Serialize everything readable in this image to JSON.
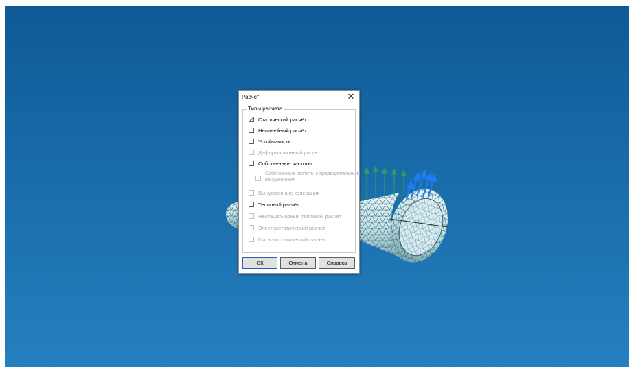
{
  "dialog": {
    "title": "Расчет",
    "close_glyph": "✕",
    "group_label": "Типы расчета",
    "options": [
      {
        "label": "Статический расчёт",
        "checked": true,
        "enabled": true
      },
      {
        "label": "Нелинейный расчёт",
        "checked": false,
        "enabled": true
      },
      {
        "label": "Устойчивость",
        "checked": false,
        "enabled": true
      },
      {
        "label": "Деформационный расчет",
        "checked": false,
        "enabled": false
      },
      {
        "label": "Собственные частоты",
        "checked": false,
        "enabled": true
      },
      {
        "label": "Собственные частоты с предварительным нагружением",
        "checked": false,
        "enabled": false
      },
      {
        "label": "Вынужденные колебания",
        "checked": false,
        "enabled": false
      },
      {
        "label": "Тепловой расчёт",
        "checked": false,
        "enabled": true
      },
      {
        "label": "Нестационарный тепловой расчёт",
        "checked": false,
        "enabled": false
      },
      {
        "label": "Электростатический расчет",
        "checked": false,
        "enabled": false
      },
      {
        "label": "Магнитостатический расчет",
        "checked": false,
        "enabled": false
      }
    ],
    "buttons": {
      "ok": "ОК",
      "cancel": "Отмена",
      "help": "Справка"
    }
  },
  "colors": {
    "viewport_top": "#0f5a96",
    "viewport_bottom": "#2580c0",
    "mesh_fill": "#bfe3ea",
    "mesh_line": "#3f5f68",
    "load_arrow": "#1e7df0",
    "constraint_arrow": "#2e9e5b"
  }
}
